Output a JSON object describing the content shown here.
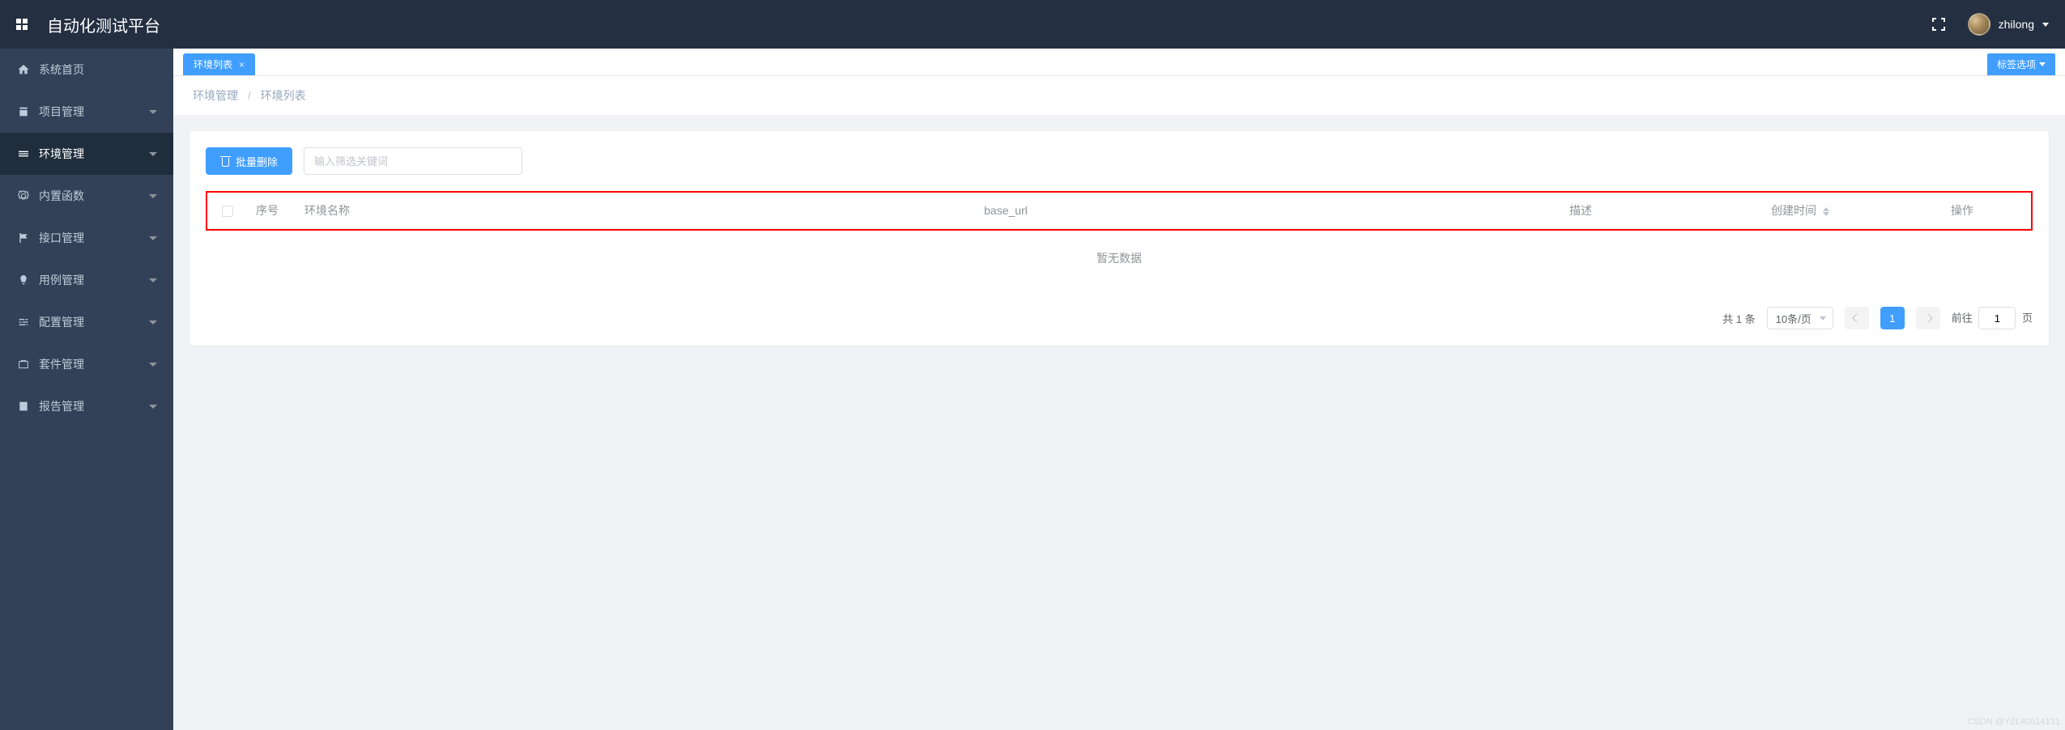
{
  "header": {
    "app_title": "自动化测试平台",
    "username": "zhilong"
  },
  "sidebar": {
    "items": [
      {
        "label": "系统首页",
        "icon": "home",
        "expandable": false
      },
      {
        "label": "项目管理",
        "icon": "project",
        "expandable": true
      },
      {
        "label": "环境管理",
        "icon": "env",
        "expandable": true,
        "active": true
      },
      {
        "label": "内置函数",
        "icon": "gear",
        "expandable": true
      },
      {
        "label": "接口管理",
        "icon": "flag",
        "expandable": true
      },
      {
        "label": "用例管理",
        "icon": "bulb",
        "expandable": true
      },
      {
        "label": "配置管理",
        "icon": "sliders",
        "expandable": true
      },
      {
        "label": "套件管理",
        "icon": "suite",
        "expandable": true
      },
      {
        "label": "报告管理",
        "icon": "report",
        "expandable": true
      }
    ]
  },
  "tabs": {
    "items": [
      {
        "label": "环境列表",
        "active": true
      }
    ],
    "options_button": "标签选项"
  },
  "breadcrumb": {
    "parent": "环境管理",
    "current": "环境列表"
  },
  "toolbar": {
    "batch_delete": "批量删除",
    "filter_placeholder": "输入筛选关键词"
  },
  "table": {
    "columns": {
      "seq": "序号",
      "name": "环境名称",
      "base_url": "base_url",
      "desc": "描述",
      "ctime": "创建时间",
      "action": "操作"
    },
    "empty_text": "暂无数据",
    "rows": []
  },
  "pagination": {
    "total_prefix": "共",
    "total_count": "1",
    "total_suffix": "条",
    "page_size_label": "10条/页",
    "current_page": "1",
    "goto_prefix": "前往",
    "goto_value": "1",
    "goto_suffix": "页"
  },
  "watermark": "CSDN @YZL40514131"
}
